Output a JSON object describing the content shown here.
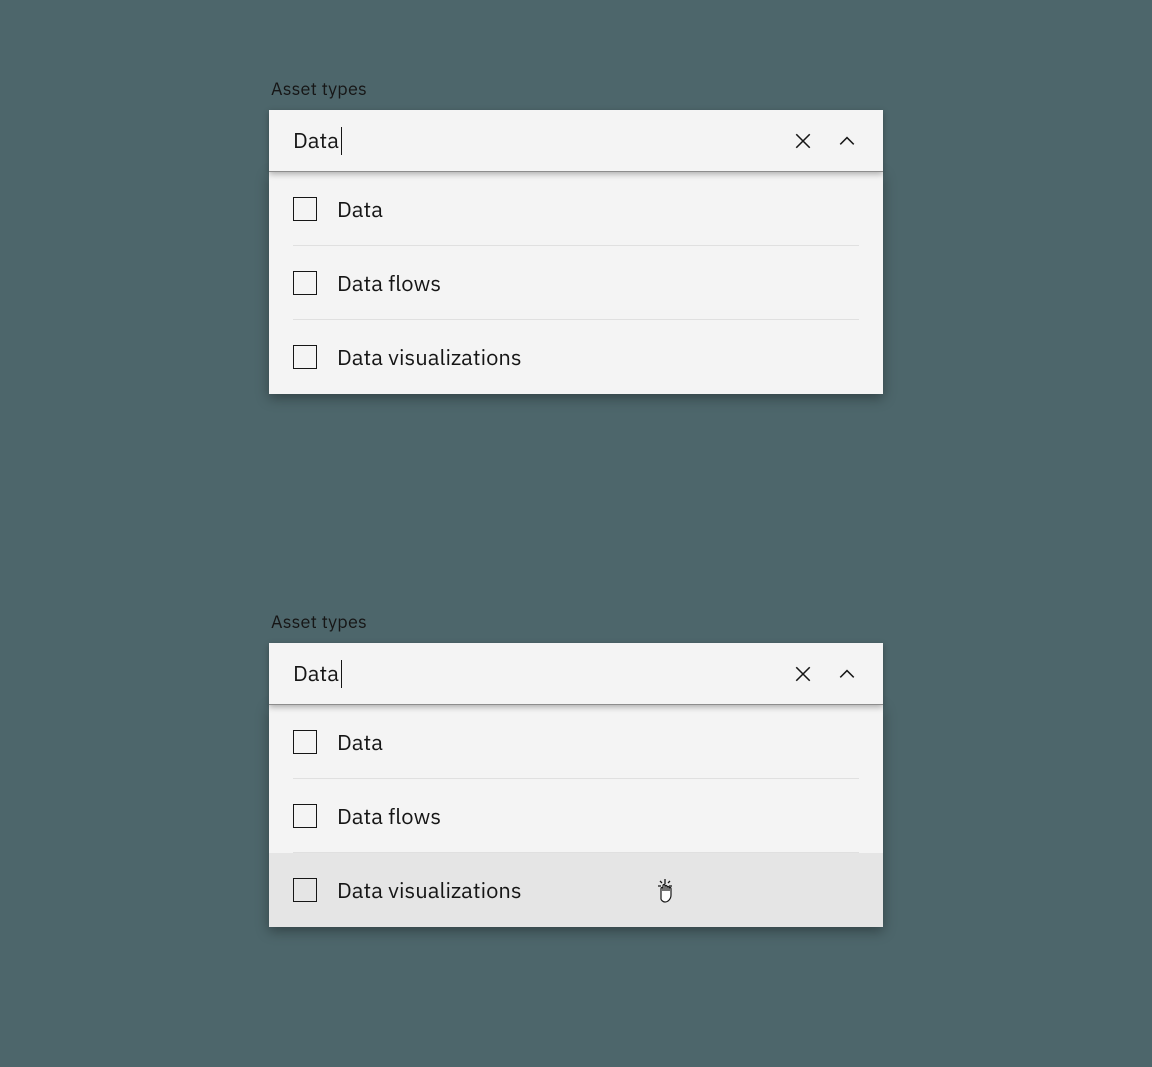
{
  "top": {
    "label": "Asset types",
    "input_value": "Data",
    "options": [
      {
        "label": "Data"
      },
      {
        "label": "Data flows"
      },
      {
        "label": "Data visualizations"
      }
    ]
  },
  "bottom": {
    "label": "Asset types",
    "input_value": "Data",
    "options": [
      {
        "label": "Data"
      },
      {
        "label": "Data flows"
      },
      {
        "label": "Data visualizations"
      }
    ],
    "hovered_index": 2
  }
}
